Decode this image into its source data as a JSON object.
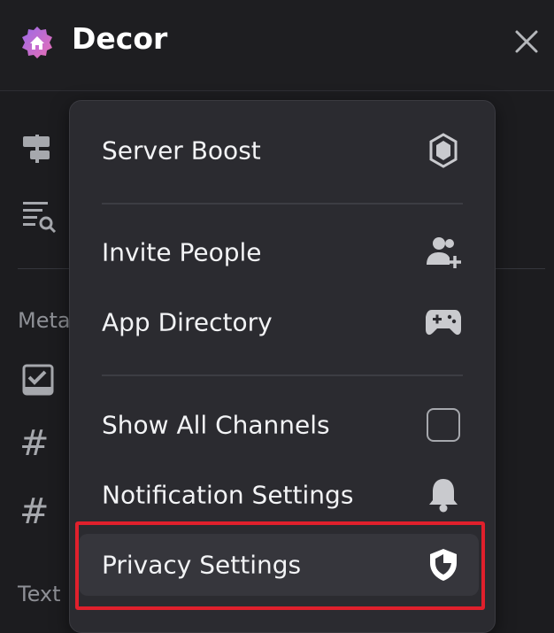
{
  "header": {
    "server_name": "Decor",
    "server_icon": "home-icon",
    "close_icon": "close-icon"
  },
  "background": {
    "category_1": "Meta",
    "category_2": "Text"
  },
  "menu": {
    "items": [
      {
        "label": "Server Boost",
        "icon": "boost-gem-icon"
      },
      {
        "label": "Invite People",
        "icon": "add-person-icon"
      },
      {
        "label": "App Directory",
        "icon": "gamepad-icon"
      },
      {
        "label": "Show All Channels",
        "icon": "checkbox-icon",
        "checked": false
      },
      {
        "label": "Notification Settings",
        "icon": "bell-icon"
      },
      {
        "label": "Privacy Settings",
        "icon": "shield-icon",
        "selected": true
      }
    ]
  },
  "colors": {
    "background": "#1c1c1f",
    "menu_bg": "#2b2b30",
    "highlight": "#e0202c",
    "brand_pink": "#e96fb5",
    "brand_purple": "#9b6ae8"
  }
}
